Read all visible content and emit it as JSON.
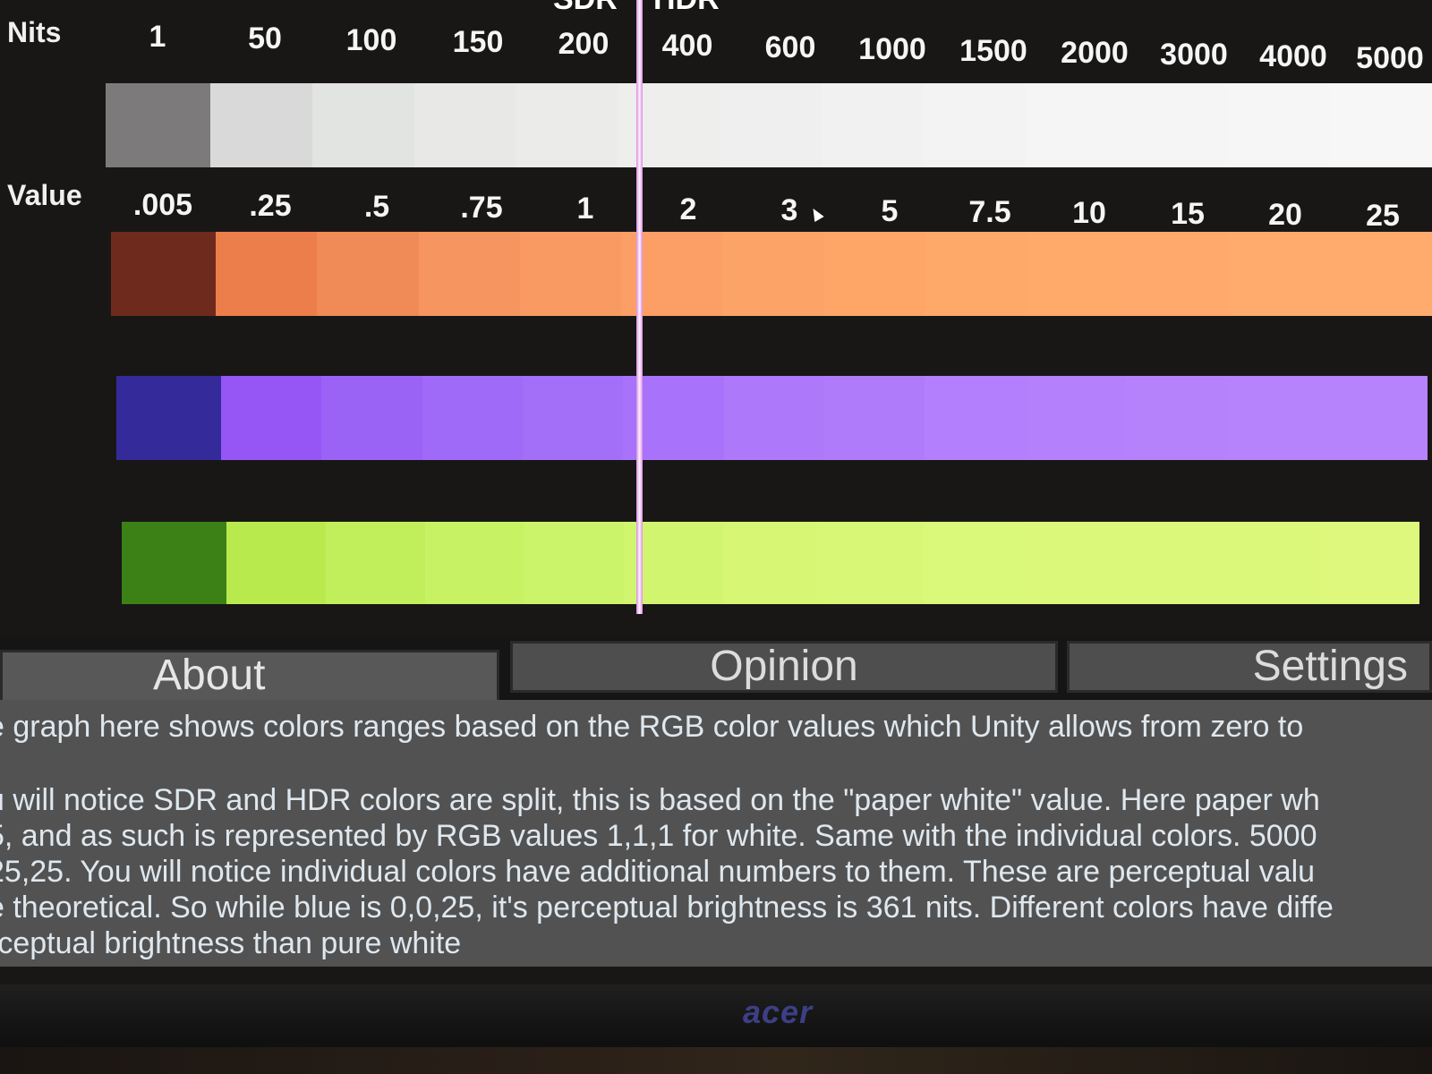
{
  "header": {
    "sdr_label": "SDR",
    "hdr_label": "HDR"
  },
  "nits_row": {
    "title": "Nits",
    "ticks": [
      "1",
      "50",
      "100",
      "150",
      "200",
      "400",
      "600",
      "1000",
      "1500",
      "2000",
      "3000",
      "4000",
      "5000"
    ]
  },
  "value_row": {
    "title": "Value",
    "ticks": [
      ".005",
      ".25",
      ".5",
      ".75",
      "1",
      "2",
      "3",
      "5",
      "7.5",
      "10",
      "15",
      "20",
      "25"
    ]
  },
  "bands": {
    "white": {
      "dark": "#7c7a7b",
      "light": "#dcdcdc",
      "steps": [
        "#d9d9d9",
        "#e2e4e2",
        "#e8e8e6",
        "#ebebe9",
        "#eeeeec",
        "#f0efef",
        "#f2f1f1",
        "#f3f3f3",
        "#f5f5f5",
        "#f5f5f5",
        "#f6f6f6",
        "#f7f7f7"
      ]
    },
    "orange": {
      "dark": "#6e2a1c",
      "steps": [
        "#ec7e4c",
        "#f08a56",
        "#f6955f",
        "#f89a62",
        "#fb9f66",
        "#fca367",
        "#fda668",
        "#fea86a",
        "#ffa96b",
        "#ffaa6c",
        "#ffab6d",
        "#ffab6d"
      ]
    },
    "purple": {
      "dark": "#342a9a",
      "steps": [
        "#9656f6",
        "#9b62f6",
        "#a06af8",
        "#a36ef8",
        "#a873fa",
        "#ad78fa",
        "#b07bfb",
        "#b37ffc",
        "#b480fc",
        "#b582fc",
        "#b683fc",
        "#b683fc"
      ]
    },
    "green": {
      "dark": "#3b8116",
      "steps": [
        "#b8ea4e",
        "#c1ef5c",
        "#c7f264",
        "#ccf46a",
        "#d2f570",
        "#d6f674",
        "#d8f777",
        "#daf879",
        "#dbf87a",
        "#dcf87b",
        "#dcf87b",
        "#ddf87c"
      ]
    }
  },
  "split_line_color": "#f4b8f6",
  "tabs": {
    "about": "About",
    "opinion": "Opinion",
    "settings": "Settings"
  },
  "description": {
    "line1": "e graph here shows colors ranges based on the RGB color values which Unity allows from zero to",
    "line2": "u will notice SDR and HDR colors are split, this is based on the \"paper white\" value. Here paper wh",
    "line3": "5, and as such is represented by RGB values 1,1,1 for white. Same with the individual colors. 5000",
    "line4": "25,25. You will notice individual colors have additional numbers to them. These are perceptual valu",
    "line5": "e theoretical. So while blue is 0,0,25, it's perceptual brightness is 361 nits. Different colors have diffe",
    "line6": "rceptual brightness than pure white"
  },
  "monitor": {
    "brand": "acer"
  }
}
